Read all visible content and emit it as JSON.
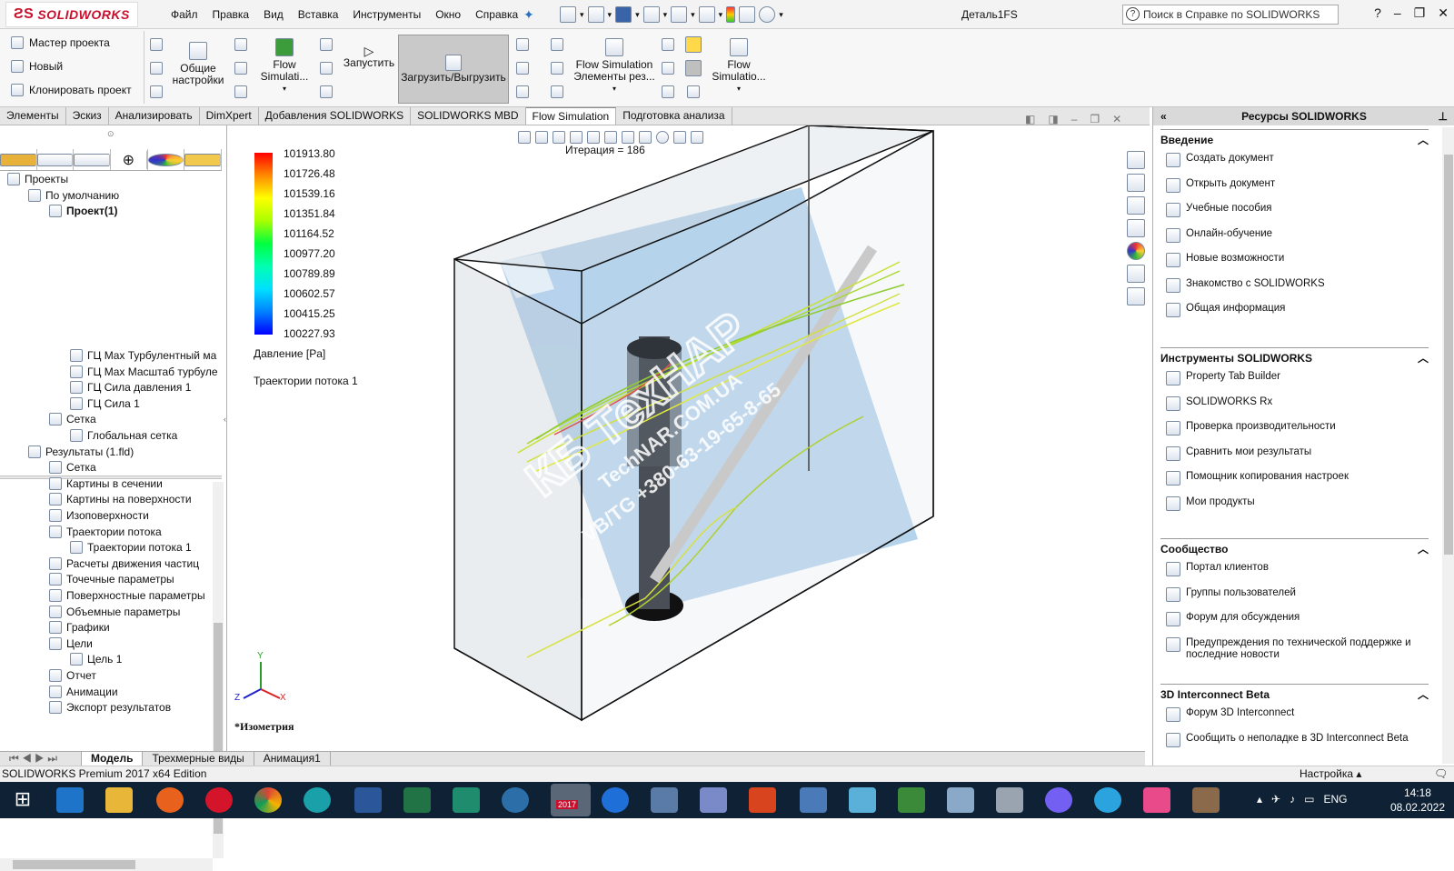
{
  "app": {
    "logo_text": "SOLIDWORKS",
    "doc_title": "Деталь1FS",
    "help_placeholder": "Поиск в Справке по SOLIDWORKS"
  },
  "menus": [
    "Файл",
    "Правка",
    "Вид",
    "Вставка",
    "Инструменты",
    "Окно",
    "Справка"
  ],
  "ribbon": {
    "small_left": [
      "Мастер проекта",
      "Новый",
      "Клонировать проект"
    ],
    "general": "Общие настройки",
    "flow1": "Flow Simulati...",
    "run": "Запустить",
    "upload": "Загрузить/Выгрузить",
    "flow_elems": "Flow Simulation Элементы рез...",
    "flow2": "Flow Simulatio..."
  },
  "tabs": [
    "Элементы",
    "Эскиз",
    "Анализировать",
    "DimXpert",
    "Добавления SOLIDWORKS",
    "SOLIDWORKS MBD",
    "Flow Simulation",
    "Подготовка анализа"
  ],
  "active_tab": "Flow Simulation",
  "tree_top": [
    {
      "label": "Проекты",
      "level": 0
    },
    {
      "label": "По умолчанию",
      "level": 1
    },
    {
      "label": "Проект(1)",
      "level": 2,
      "bold": true
    }
  ],
  "tree_bottom": [
    {
      "label": "ГЦ Max Турбулентный ма",
      "level": 3
    },
    {
      "label": "ГЦ Max Масштаб турбуле",
      "level": 3
    },
    {
      "label": "ГЦ Сила давления 1",
      "level": 3
    },
    {
      "label": "ГЦ Сила 1",
      "level": 3
    },
    {
      "label": "Сетка",
      "level": 2
    },
    {
      "label": "Глобальная сетка",
      "level": 3
    },
    {
      "label": "Результаты (1.fld)",
      "level": 1
    },
    {
      "label": "Сетка",
      "level": 2
    },
    {
      "label": "Картины в сечении",
      "level": 2
    },
    {
      "label": "Картины на поверхности",
      "level": 2
    },
    {
      "label": "Изоповерхности",
      "level": 2
    },
    {
      "label": "Траектории потока",
      "level": 2
    },
    {
      "label": "Траектории потока 1",
      "level": 3
    },
    {
      "label": "Расчеты движения частиц",
      "level": 2
    },
    {
      "label": "Точечные параметры",
      "level": 2
    },
    {
      "label": "Поверхностные параметры",
      "level": 2
    },
    {
      "label": "Объемные параметры",
      "level": 2
    },
    {
      "label": "Графики",
      "level": 2
    },
    {
      "label": "Цели",
      "level": 2
    },
    {
      "label": "Цель 1",
      "level": 3
    },
    {
      "label": "Отчет",
      "level": 2
    },
    {
      "label": "Анимации",
      "level": 2
    },
    {
      "label": "Экспорт результатов",
      "level": 2
    }
  ],
  "viewport": {
    "legend_values": [
      "101913.80",
      "101726.48",
      "101539.16",
      "101351.84",
      "101164.52",
      "100977.20",
      "100789.89",
      "100602.57",
      "100415.25",
      "100227.93"
    ],
    "legend_unit": "Давление [Pa]",
    "trajectory_label": "Траектории потока 1",
    "iteration": "Итерация = 186",
    "view_name": "*Изометрия",
    "watermark_big": "КБ ТехНАР",
    "watermark_site": "TechNAR.COM.UA",
    "watermark_phone": "VB/TG +380-63-19-65-8-65",
    "axis_x": "X",
    "axis_y": "Y",
    "axis_z": "Z"
  },
  "bottom_tabs": [
    "Модель",
    "Трехмерные виды",
    "Анимация1"
  ],
  "status": {
    "edition": "SOLIDWORKS Premium 2017 x64 Edition",
    "setting": "Настройка"
  },
  "resources": {
    "title": "Ресурсы SOLIDWORKS",
    "sections": [
      {
        "name": "Введение",
        "items": [
          "Создать документ",
          "Открыть документ",
          "Учебные пособия",
          "Онлайн-обучение",
          "Новые возможности",
          "Знакомство с SOLIDWORKS",
          "Общая информация"
        ]
      },
      {
        "name": "Инструменты SOLIDWORKS",
        "items": [
          "Property Tab Builder",
          "SOLIDWORKS Rx",
          "Проверка производительности",
          "Сравнить мои результаты",
          "Помощник копирования настроек",
          "Мои продукты"
        ]
      },
      {
        "name": "Сообщество",
        "items": [
          "Портал клиентов",
          "Группы пользователей",
          "Форум для обсуждения",
          "Предупреждения по технической поддержке и последние новости"
        ]
      },
      {
        "name": "3D Interconnect Beta",
        "items": [
          "Форум 3D Interconnect",
          "Сообщить о неполадке в 3D Interconnect Beta"
        ]
      }
    ]
  },
  "taskbar": {
    "lang": "ENG",
    "time": "14:18",
    "date": "08.02.2022",
    "sw_badge": "2017"
  }
}
